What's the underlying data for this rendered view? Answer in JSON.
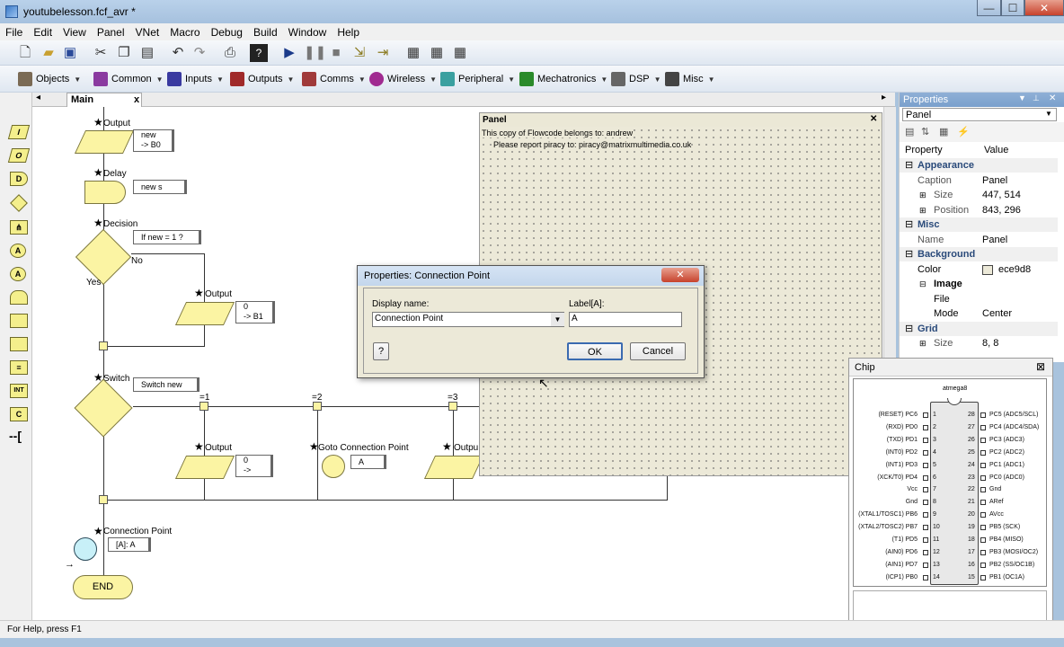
{
  "window": {
    "title": "youtubelesson.fcf_avr *",
    "minimize": "—",
    "maximize": "☐",
    "close": "✕"
  },
  "menu": [
    "File",
    "Edit",
    "View",
    "Panel",
    "VNet",
    "Macro",
    "Debug",
    "Build",
    "Window",
    "Help"
  ],
  "toolbar2": [
    {
      "label": "Objects",
      "color": "#7a6a55"
    },
    {
      "label": "Common",
      "color": "#8a3aa0"
    },
    {
      "label": "Inputs",
      "color": "#3a3aa0"
    },
    {
      "label": "Outputs",
      "color": "#a02a2a"
    },
    {
      "label": "Comms",
      "color": "#a03a3a"
    },
    {
      "label": "Wireless",
      "color": "#a02a90"
    },
    {
      "label": "Peripheral",
      "color": "#3aa0a0"
    },
    {
      "label": "Mechatronics",
      "color": "#2a8a2a"
    },
    {
      "label": "DSP",
      "color": "#666666"
    },
    {
      "label": "Misc",
      "color": "#444444"
    }
  ],
  "tabs": {
    "main": "Main",
    "close": "x",
    "left_arrow": "◂",
    "right_arrow": "▸"
  },
  "flow": {
    "output1_label": "Output",
    "output1_note": "new\n-> B0",
    "delay_label": "Delay",
    "delay_note": "new s",
    "decision_label": "Decision",
    "decision_note": "If new = 1 ?",
    "yes": "Yes",
    "no": "No",
    "output2_label": "Output",
    "output2_note": "0\n-> B1",
    "switch_label": "Switch",
    "switch_note": "Switch new",
    "case1": "=1",
    "case2": "=2",
    "case3": "=3",
    "output3_label": "Output",
    "output3_note": "0\n->",
    "goto_label": "Goto Connection Point",
    "goto_note": "A",
    "output4_label": "Outpu",
    "conn_label": "Connection Point",
    "conn_note": "[A]: A",
    "end": "END",
    "arrow": "→"
  },
  "panel": {
    "title": "Panel",
    "close": "✕",
    "copy_line1": "This copy of Flowcode belongs to: andrew",
    "copy_line2": "Please report piracy to: piracy@matrixmultimedia.co.uk"
  },
  "properties": {
    "header": "Properties",
    "selector": "Panel",
    "col_property": "Property",
    "col_value": "Value",
    "rows": [
      {
        "k": "Appearance",
        "v": "",
        "type": "group"
      },
      {
        "k": "Caption",
        "v": "Panel",
        "type": "item"
      },
      {
        "k": "Size",
        "v": "447, 514",
        "type": "exp"
      },
      {
        "k": "Position",
        "v": "843, 296",
        "type": "exp"
      },
      {
        "k": "Misc",
        "v": "",
        "type": "group"
      },
      {
        "k": "Name",
        "v": "Panel",
        "type": "item"
      },
      {
        "k": "Background",
        "v": "",
        "type": "group"
      },
      {
        "k": "Color",
        "v": "ece9d8",
        "type": "color"
      },
      {
        "k": "Image",
        "v": "",
        "type": "sub"
      },
      {
        "k": "File",
        "v": "",
        "type": "item2"
      },
      {
        "k": "Mode",
        "v": "Center",
        "type": "item2"
      },
      {
        "k": "Grid",
        "v": "",
        "type": "group"
      },
      {
        "k": "Size",
        "v": "8, 8",
        "type": "exp"
      }
    ],
    "color_swatch": "#ece9d8"
  },
  "chip": {
    "title": "Chip",
    "close": "⊠",
    "name": "atmega8",
    "left_pins": [
      {
        "n": "1",
        "l": "(RESET) PC6"
      },
      {
        "n": "2",
        "l": "(RXD) PD0"
      },
      {
        "n": "3",
        "l": "(TXD) PD1"
      },
      {
        "n": "4",
        "l": "(INT0) PD2"
      },
      {
        "n": "5",
        "l": "(INT1) PD3"
      },
      {
        "n": "6",
        "l": "(XCK/T0) PD4"
      },
      {
        "n": "7",
        "l": "Vcc"
      },
      {
        "n": "8",
        "l": "Gnd"
      },
      {
        "n": "9",
        "l": "(XTAL1/TOSC1) PB6"
      },
      {
        "n": "10",
        "l": "(XTAL2/TOSC2) PB7"
      },
      {
        "n": "11",
        "l": "(T1) PD5"
      },
      {
        "n": "12",
        "l": "(AIN0) PD6"
      },
      {
        "n": "13",
        "l": "(AIN1) PD7"
      },
      {
        "n": "14",
        "l": "(ICP1) PB0"
      }
    ],
    "right_pins": [
      {
        "n": "28",
        "l": "PC5 (ADC5/SCL)"
      },
      {
        "n": "27",
        "l": "PC4 (ADC4/SDA)"
      },
      {
        "n": "26",
        "l": "PC3 (ADC3)"
      },
      {
        "n": "25",
        "l": "PC2 (ADC2)"
      },
      {
        "n": "24",
        "l": "PC1 (ADC1)"
      },
      {
        "n": "23",
        "l": "PC0 (ADC0)"
      },
      {
        "n": "22",
        "l": "Gnd"
      },
      {
        "n": "21",
        "l": "ARef"
      },
      {
        "n": "20",
        "l": "AVcc"
      },
      {
        "n": "19",
        "l": "PB5 (SCK)"
      },
      {
        "n": "18",
        "l": "PB4 (MISO)"
      },
      {
        "n": "17",
        "l": "PB3 (MOSI/OC2)"
      },
      {
        "n": "16",
        "l": "PB2 (SS/OC1B)"
      },
      {
        "n": "15",
        "l": "PB1 (OC1A)"
      }
    ]
  },
  "dialog": {
    "title": "Properties: Connection Point",
    "close": "✕",
    "display_name_label": "Display name:",
    "display_name_value": "Connection Point",
    "label_label": "Label[A]:",
    "label_value": "A",
    "help": "?",
    "ok": "OK",
    "cancel": "Cancel",
    "dropdown": "▼"
  },
  "status": {
    "text": "For Help, press F1"
  }
}
